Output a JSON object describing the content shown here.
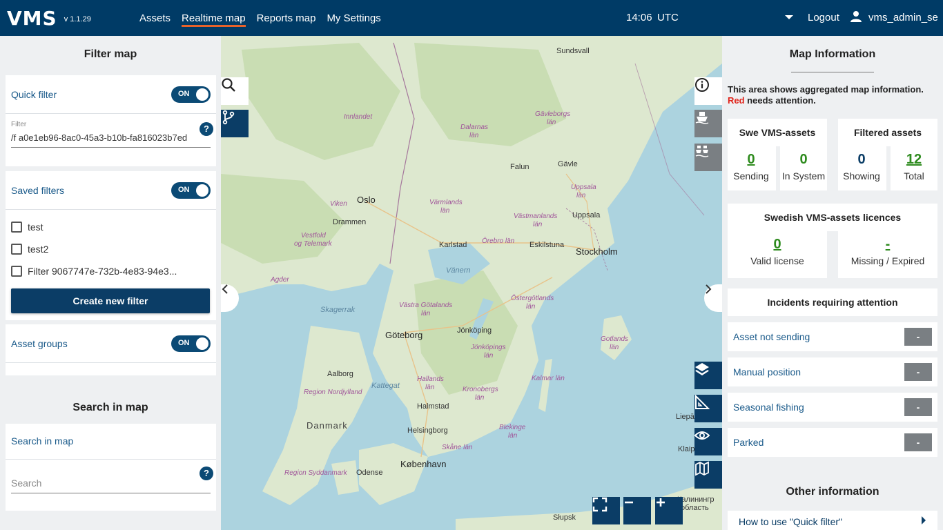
{
  "header": {
    "logo": "VMS",
    "version": "v 1.1.29",
    "nav": [
      "Assets",
      "Realtime map",
      "Reports map",
      "My Settings"
    ],
    "time": "14:06",
    "timezone": "UTC",
    "logout": "Logout",
    "username": "vms_admin_se"
  },
  "filter_panel": {
    "title": "Filter map",
    "quick_filter_label": "Quick filter",
    "toggle_on": "ON",
    "filter_field_label": "Filter",
    "filter_value": "/f a0e1eb96-8ac0-45a3-b10b-fa816023b7ed",
    "saved_filters_label": "Saved filters",
    "saved_filters": [
      "test",
      "test2",
      "Filter 9067747e-732b-4e83-94e3..."
    ],
    "create_button": "Create new filter",
    "asset_groups_label": "Asset groups"
  },
  "search_panel": {
    "title": "Search in map",
    "label": "Search in map",
    "placeholder": "Search",
    "help": "?"
  },
  "map": {
    "labels": {
      "sundsvall": "Sundsvall",
      "gavleborgs": "Gävleborgs",
      "lan": "län",
      "dalarnas": "Dalarnas",
      "innlandet": "Innlandet",
      "falun": "Falun",
      "gavle": "Gävle",
      "uppsala_lan": "Uppsala",
      "uppsala": "Uppsala",
      "oslo": "Oslo",
      "viken": "Viken",
      "drammen": "Drammen",
      "varmlands": "Värmlands",
      "vastmanlands": "Västmanlands",
      "vestfold": "Vestfold",
      "og_telemark": "og Telemark",
      "karlstad": "Karlstad",
      "orebro": "Örebro län",
      "eskilstuna": "Eskilstuna",
      "stockholm": "Stockholm",
      "agder": "Agder",
      "vanern": "Vänern",
      "skagerrak": "Skagerrak",
      "vastra_gotalands": "Västra Götalands",
      "ostergotlands": "Östergötlands",
      "goteborg": "Göteborg",
      "jonkoping": "Jönköping",
      "jonkopings": "Jönköpings",
      "gotlands": "Gotlands",
      "aalborg": "Aalborg",
      "hallands": "Hallands",
      "kronobergs": "Kronobergs",
      "kalmar_lan": "Kalmar län",
      "region_nordjylland": "Region Nordjylland",
      "kattegat": "Kattegat",
      "halmstad": "Halmstad",
      "danmark": "Danmark",
      "helsingborg": "Helsingborg",
      "blekinge": "Blekinge",
      "skane_lan": "Skåne län",
      "kobenhavn": "København",
      "odense": "Odense",
      "region_syddanmark": "Region Syddanmark",
      "liepaja": "Liepā",
      "klaip": "Klaip",
      "slupsk": "Słupsk",
      "kaliningrad_obl": "Калинингр",
      "oblast": "область"
    }
  },
  "info_panel": {
    "title": "Map Information",
    "text_main": "This area shows aggregated map information.",
    "text_red": "Red",
    "text_rest": " needs attention.",
    "swe_title": "Swe VMS-assets",
    "sending_value": "0",
    "sending_label": "Sending",
    "insystem_value": "0",
    "insystem_label": "In System",
    "filtered_title": "Filtered assets",
    "showing_value": "0",
    "showing_label": "Showing",
    "total_value": "12",
    "total_label": "Total",
    "licences_title": "Swedish VMS-assets licences",
    "valid_value": "0",
    "valid_label": "Valid license",
    "missing_value": "-",
    "missing_label": "Missing / Expired",
    "incidents_title": "Incidents requiring attention",
    "incidents": [
      {
        "label": "Asset not sending",
        "value": "-"
      },
      {
        "label": "Manual position",
        "value": "-"
      },
      {
        "label": "Seasonal fishing",
        "value": "-"
      },
      {
        "label": "Parked",
        "value": "-"
      }
    ],
    "other_title": "Other information",
    "other_link": "How to use \"Quick filter\""
  },
  "colors": {
    "header_bg": "#003b66",
    "active_underline": "#e8622a",
    "primary": "#0b3d66",
    "green_value": "#2e8b1e",
    "attention_red": "#e0241b",
    "badge_grey": "#7a7f83"
  },
  "icons": [
    "search-icon",
    "route-icon",
    "info-icon",
    "ship-icon",
    "ship-group-icon",
    "layers-icon",
    "ruler-icon",
    "eye-icon",
    "map-icon",
    "fullscreen-icon",
    "user-icon",
    "chevron-left-icon",
    "chevron-right-icon",
    "caret-right-icon"
  ]
}
